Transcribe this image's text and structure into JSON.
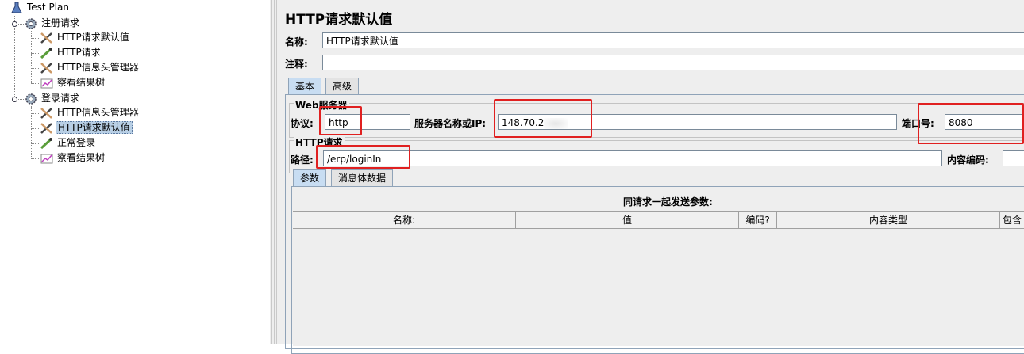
{
  "tree": {
    "root": "Test Plan",
    "group1": "注册请求",
    "g1_items": [
      "HTTP请求默认值",
      "HTTP请求",
      "HTTP信息头管理器",
      "察看结果树"
    ],
    "group2": "登录请求",
    "g2_items": [
      "HTTP信息头管理器",
      "HTTP请求默认值",
      "正常登录",
      "察看结果树"
    ]
  },
  "panel": {
    "title": "HTTP请求默认值",
    "name_label": "名称:",
    "name_value": "HTTP请求默认值",
    "comment_label": "注释:",
    "comment_value": "",
    "tabs": [
      "基本",
      "高级"
    ],
    "web_server_legend": "Web服务器",
    "protocol_label": "协议:",
    "protocol_value": "http",
    "server_label": "服务器名称或IP:",
    "server_value": "148.70.2",
    "port_label": "端口号:",
    "port_value": "8080",
    "http_request_legend": "HTTP请求",
    "path_label": "路径:",
    "path_value": "/erp/loginIn",
    "encoding_label": "内容编码:",
    "encoding_value": "",
    "sub_tabs": [
      "参数",
      "消息体数据"
    ],
    "params_caption": "同请求一起发送参数:",
    "columns": [
      "名称:",
      "值",
      "编码?",
      "内容类型",
      "包含"
    ]
  },
  "colors": {
    "highlight": "#e02020",
    "selection": "#b8cfe5",
    "active_tab": "#c8ddf2"
  }
}
